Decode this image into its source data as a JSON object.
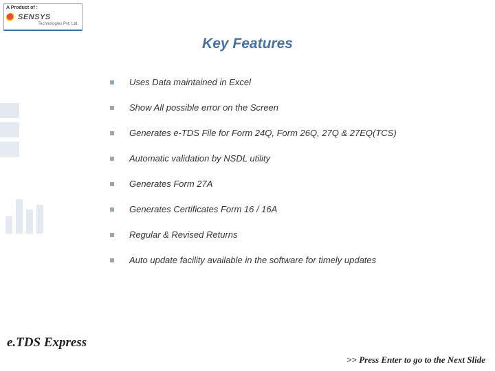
{
  "product_box": {
    "top_label": "A Product of :",
    "brand": "SENSYS",
    "tagline": "Technologies Pvt. Ltd."
  },
  "title": "Key Features",
  "features": [
    "Uses Data maintained in Excel",
    "Show All possible error on the Screen",
    "Generates e-TDS File for Form 24Q, Form 26Q, 27Q & 27EQ(TCS)",
    "Automatic validation by NSDL utility",
    "Generates Form 27A",
    "Generates Certificates Form 16 / 16A",
    "Regular & Revised Returns",
    "Auto update facility available in the software for timely updates"
  ],
  "product_name": "e.TDS Express",
  "footer_hint": ">> Press Enter to go to the Next Slide"
}
